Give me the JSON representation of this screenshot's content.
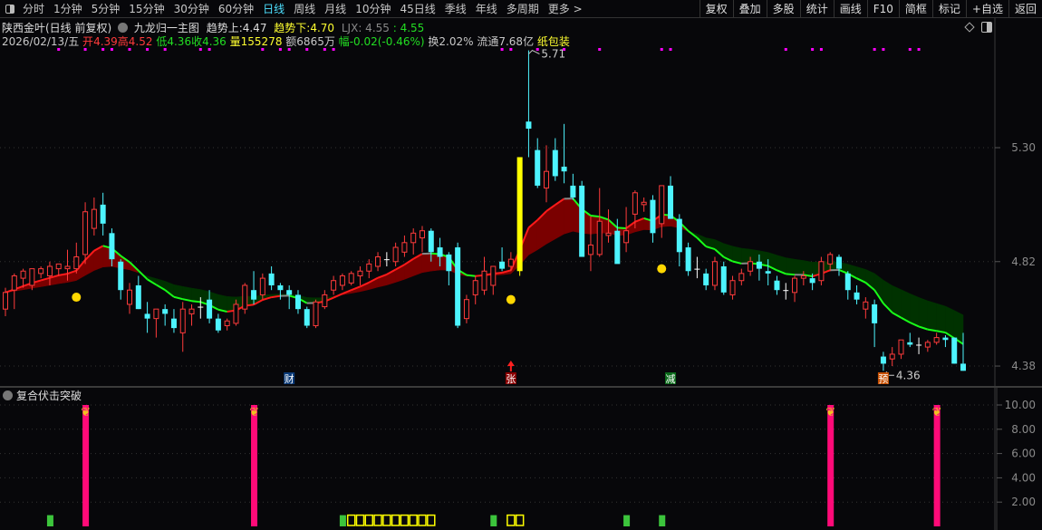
{
  "toolbar": {
    "periods": [
      "分时",
      "1分钟",
      "5分钟",
      "15分钟",
      "30分钟",
      "60分钟",
      "日线",
      "周线",
      "月线",
      "10分钟",
      "45日线",
      "季线",
      "年线",
      "多周期",
      "更多 >"
    ],
    "active_period": "日线",
    "right_buttons": [
      "复权",
      "叠加",
      "多股",
      "统计",
      "画线",
      "F10",
      "简框",
      "标记",
      "+自选",
      "返回"
    ]
  },
  "header": {
    "stock_name": "陕西金叶(日线 前复权)",
    "indicator_name": "九龙归一主图",
    "trend_up_label": "趋势上:",
    "trend_up_value": "4.47",
    "trend_down_label": "趋势下:",
    "trend_down_value": "4.70",
    "ljx_label": "LJX: 4.55",
    "ljx_value": ": 4.55"
  },
  "quote": {
    "date": "2026/02/13/五",
    "open_label": "开",
    "open": "4.39",
    "high_label": "高",
    "high": "4.52",
    "low_label": "低",
    "low": "4.36",
    "close_label": "收",
    "close": "4.36",
    "volume_label": "量",
    "volume": "155278",
    "amount": "额6865万",
    "change_label": "幅",
    "change": "-0.02(-0.46%)",
    "turnover": "换2.02%",
    "float_cap": "流通7.68亿",
    "sector": "纸包装"
  },
  "lower_panel": {
    "title": "复合伏击突破"
  },
  "colors": {
    "up": "#ff3b3b",
    "down": "#4df4ff",
    "doji": "#ffffff",
    "limit_up": "#ffff00",
    "trend_up": "#ff1a1a",
    "trend_down": "#19ff19",
    "band_up": "#7a0000",
    "band_down": "#003200",
    "signal_pink": "#ff0a78",
    "signal_green": "#3cc43c",
    "signal_yellow": "#ffff00",
    "marker_magenta": "#ff00ff",
    "dot_yellow": "#ffd700"
  },
  "chart_data": {
    "type": "candlestick",
    "price_axis": {
      "ticks": [
        "5.30",
        "4.82",
        "4.38"
      ],
      "range": [
        4.3,
        5.75
      ]
    },
    "high_label": "5.71",
    "low_label": "4.36",
    "candles": [
      [
        4.62,
        4.71,
        4.59,
        4.69
      ],
      [
        4.7,
        4.77,
        4.62,
        4.76
      ],
      [
        4.75,
        4.79,
        4.71,
        4.78
      ],
      [
        4.72,
        4.79,
        4.7,
        4.79
      ],
      [
        4.77,
        4.8,
        4.75,
        4.79
      ],
      [
        4.76,
        4.82,
        4.72,
        4.8
      ],
      [
        4.79,
        4.81,
        4.76,
        4.81
      ],
      [
        4.79,
        4.87,
        4.74,
        4.8
      ],
      [
        4.79,
        4.9,
        4.77,
        4.84
      ],
      [
        4.85,
        5.07,
        4.81,
        5.03
      ],
      [
        4.96,
        5.09,
        4.93,
        5.04
      ],
      [
        5.06,
        5.11,
        4.93,
        4.98
      ],
      [
        4.94,
        4.96,
        4.8,
        4.83
      ],
      [
        4.82,
        4.83,
        4.66,
        4.7
      ],
      [
        4.64,
        4.73,
        4.6,
        4.7
      ],
      [
        4.72,
        4.76,
        4.62,
        4.62
      ],
      [
        4.6,
        4.65,
        4.52,
        4.58
      ],
      [
        4.58,
        4.62,
        4.5,
        4.62
      ],
      [
        4.62,
        4.64,
        4.55,
        4.6
      ],
      [
        4.58,
        4.62,
        4.52,
        4.54
      ],
      [
        4.52,
        4.65,
        4.44,
        4.62
      ],
      [
        4.6,
        4.64,
        4.55,
        4.62
      ],
      [
        4.63,
        4.67,
        4.58,
        4.63
      ],
      [
        4.66,
        4.7,
        4.56,
        4.58
      ],
      [
        4.58,
        4.6,
        4.52,
        4.53
      ],
      [
        4.55,
        4.58,
        4.53,
        4.57
      ],
      [
        4.56,
        4.66,
        4.55,
        4.64
      ],
      [
        4.62,
        4.73,
        4.6,
        4.72
      ],
      [
        4.7,
        4.78,
        4.64,
        4.66
      ],
      [
        4.68,
        4.77,
        4.66,
        4.75
      ],
      [
        4.77,
        4.8,
        4.7,
        4.72
      ],
      [
        4.72,
        4.73,
        4.66,
        4.7
      ],
      [
        4.7,
        4.72,
        4.62,
        4.68
      ],
      [
        4.68,
        4.7,
        4.6,
        4.62
      ],
      [
        4.62,
        4.63,
        4.54,
        4.55
      ],
      [
        4.55,
        4.66,
        4.54,
        4.65
      ],
      [
        4.63,
        4.7,
        4.62,
        4.68
      ],
      [
        4.7,
        4.76,
        4.68,
        4.74
      ],
      [
        4.72,
        4.77,
        4.7,
        4.76
      ],
      [
        4.73,
        4.78,
        4.72,
        4.77
      ],
      [
        4.76,
        4.8,
        4.72,
        4.78
      ],
      [
        4.78,
        4.83,
        4.75,
        4.81
      ],
      [
        4.8,
        4.86,
        4.78,
        4.84
      ],
      [
        4.83,
        4.86,
        4.8,
        4.83
      ],
      [
        4.82,
        4.9,
        4.8,
        4.88
      ],
      [
        4.86,
        4.93,
        4.84,
        4.9
      ],
      [
        4.9,
        4.96,
        4.85,
        4.94
      ],
      [
        4.92,
        4.97,
        4.86,
        4.95
      ],
      [
        4.95,
        4.96,
        4.82,
        4.86
      ],
      [
        4.88,
        4.92,
        4.8,
        4.84
      ],
      [
        4.85,
        4.86,
        4.72,
        4.78
      ],
      [
        4.88,
        4.9,
        4.54,
        4.55
      ],
      [
        4.58,
        4.68,
        4.56,
        4.66
      ],
      [
        4.68,
        4.76,
        4.64,
        4.74
      ],
      [
        4.7,
        4.84,
        4.68,
        4.78
      ],
      [
        4.72,
        4.8,
        4.68,
        4.8
      ],
      [
        4.82,
        4.88,
        4.78,
        4.79
      ],
      [
        4.8,
        4.86,
        4.78,
        4.83
      ],
      [
        4.78,
        5.26,
        4.76,
        5.26
      ],
      [
        5.41,
        5.71,
        5.26,
        5.38
      ],
      [
        5.29,
        5.34,
        5.13,
        5.14
      ],
      [
        5.13,
        5.31,
        5.07,
        5.2
      ],
      [
        5.29,
        5.34,
        5.16,
        5.18
      ],
      [
        5.22,
        5.4,
        5.15,
        5.2
      ],
      [
        5.14,
        5.19,
        5.08,
        5.09
      ],
      [
        5.14,
        5.16,
        4.84,
        4.84
      ],
      [
        4.85,
        5.01,
        4.78,
        4.89
      ],
      [
        4.85,
        5.13,
        4.84,
        4.99
      ],
      [
        4.93,
        5.04,
        4.9,
        4.94
      ],
      [
        4.95,
        5.0,
        4.82,
        4.81
      ],
      [
        4.9,
        5.05,
        4.86,
        4.95
      ],
      [
        5.02,
        5.12,
        4.96,
        5.11
      ],
      [
        5.06,
        5.09,
        5.03,
        5.07
      ],
      [
        5.08,
        5.1,
        4.9,
        4.94
      ],
      [
        4.98,
        5.12,
        4.92,
        5.14
      ],
      [
        5.14,
        5.18,
        5.0,
        5.0
      ],
      [
        5.0,
        5.02,
        4.8,
        4.86
      ],
      [
        4.88,
        4.9,
        4.76,
        4.78
      ],
      [
        4.79,
        4.84,
        4.75,
        4.79
      ],
      [
        4.77,
        4.79,
        4.7,
        4.72
      ],
      [
        4.72,
        4.84,
        4.7,
        4.82
      ],
      [
        4.8,
        4.82,
        4.68,
        4.69
      ],
      [
        4.68,
        4.76,
        4.66,
        4.74
      ],
      [
        4.74,
        4.79,
        4.72,
        4.77
      ],
      [
        4.78,
        4.84,
        4.76,
        4.82
      ],
      [
        4.82,
        4.85,
        4.74,
        4.79
      ],
      [
        4.78,
        4.83,
        4.72,
        4.77
      ],
      [
        4.74,
        4.76,
        4.68,
        4.7
      ],
      [
        4.7,
        4.73,
        4.66,
        4.7
      ],
      [
        4.69,
        4.76,
        4.65,
        4.75
      ],
      [
        4.75,
        4.78,
        4.72,
        4.76
      ],
      [
        4.75,
        4.77,
        4.7,
        4.73
      ],
      [
        4.74,
        4.84,
        4.72,
        4.82
      ],
      [
        4.81,
        4.86,
        4.78,
        4.85
      ],
      [
        4.84,
        4.85,
        4.76,
        4.79
      ],
      [
        4.77,
        4.78,
        4.66,
        4.7
      ],
      [
        4.69,
        4.72,
        4.64,
        4.66
      ],
      [
        4.62,
        4.67,
        4.58,
        4.65
      ],
      [
        4.64,
        4.66,
        4.46,
        4.56
      ],
      [
        4.42,
        4.44,
        4.36,
        4.39
      ],
      [
        4.41,
        4.46,
        4.38,
        4.43
      ],
      [
        4.43,
        4.49,
        4.41,
        4.49
      ],
      [
        4.48,
        4.52,
        4.46,
        4.47
      ],
      [
        4.47,
        4.5,
        4.43,
        4.47
      ],
      [
        4.46,
        4.49,
        4.44,
        4.48
      ],
      [
        4.48,
        4.52,
        4.47,
        4.5
      ],
      [
        4.5,
        4.51,
        4.46,
        4.49
      ],
      [
        4.5,
        4.5,
        4.39,
        4.39
      ],
      [
        4.39,
        4.52,
        4.36,
        4.36
      ]
    ],
    "limit_up_candle": 58,
    "magenta_markers": [
      6,
      9,
      11,
      12,
      14,
      16,
      18,
      22,
      23,
      29,
      31,
      32,
      34,
      36,
      37,
      56,
      57,
      60,
      63,
      67,
      74,
      75,
      88,
      91,
      92,
      98,
      99,
      102,
      103
    ],
    "yellow_dots": [
      {
        "index": 8,
        "price": 4.67
      },
      {
        "index": 57,
        "price": 4.66
      },
      {
        "index": 74,
        "price": 4.79
      }
    ],
    "event_labels": [
      {
        "index": 32,
        "text": "财",
        "bg": "#0a3a78"
      },
      {
        "index": 57,
        "text": "张",
        "bg": "#8a0000",
        "arrow": true
      },
      {
        "index": 75,
        "text": "减",
        "bg": "#0a6a1a"
      },
      {
        "index": 99,
        "text": "预",
        "bg": "#c85000"
      }
    ],
    "lower": {
      "axis_ticks": [
        "10.00",
        "8.00",
        "6.00",
        "4.00",
        "2.00"
      ],
      "range": [
        0,
        10
      ],
      "pink_bars": [
        {
          "index": 9,
          "value": 10
        },
        {
          "index": 28,
          "value": 10
        },
        {
          "index": 93,
          "value": 10
        },
        {
          "index": 105,
          "value": 10
        }
      ],
      "green_bars": [
        {
          "index": 5,
          "value": 1
        },
        {
          "index": 38,
          "value": 1
        },
        {
          "index": 55,
          "value": 1
        },
        {
          "index": 70,
          "value": 1
        },
        {
          "index": 74,
          "value": 1
        }
      ],
      "yellow_boxes": [
        {
          "index": 39,
          "value": 1
        },
        {
          "index": 40,
          "value": 1
        },
        {
          "index": 41,
          "value": 1
        },
        {
          "index": 42,
          "value": 1
        },
        {
          "index": 43,
          "value": 1
        },
        {
          "index": 44,
          "value": 1
        },
        {
          "index": 45,
          "value": 1
        },
        {
          "index": 46,
          "value": 1
        },
        {
          "index": 47,
          "value": 1
        },
        {
          "index": 48,
          "value": 1
        },
        {
          "index": 57,
          "value": 1
        },
        {
          "index": 58,
          "value": 1
        }
      ]
    }
  }
}
